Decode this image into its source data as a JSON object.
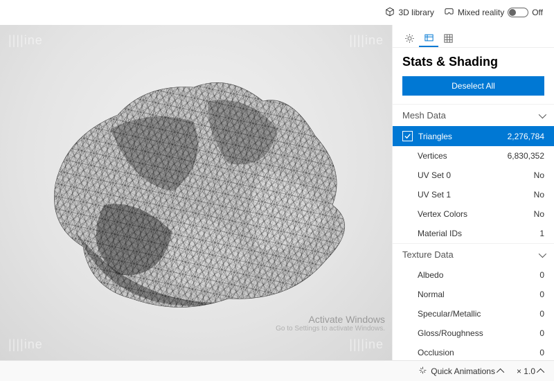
{
  "topbar": {
    "library_label": "3D library",
    "mr_label": "Mixed reality",
    "mr_state": "Off"
  },
  "panel": {
    "title": "Stats & Shading",
    "deselect_label": "Deselect All",
    "sections": {
      "mesh": {
        "title": "Mesh Data"
      },
      "texture": {
        "title": "Texture Data"
      }
    },
    "mesh_rows": [
      {
        "label": "Triangles",
        "value": "2,276,784",
        "selected": true
      },
      {
        "label": "Vertices",
        "value": "6,830,352"
      },
      {
        "label": "UV Set 0",
        "value": "No"
      },
      {
        "label": "UV Set 1",
        "value": "No"
      },
      {
        "label": "Vertex Colors",
        "value": "No"
      },
      {
        "label": "Material IDs",
        "value": "1"
      }
    ],
    "texture_rows": [
      {
        "label": "Albedo",
        "value": "0"
      },
      {
        "label": "Normal",
        "value": "0"
      },
      {
        "label": "Specular/Metallic",
        "value": "0"
      },
      {
        "label": "Gloss/Roughness",
        "value": "0"
      },
      {
        "label": "Occlusion",
        "value": "0"
      }
    ]
  },
  "statusbar": {
    "anim_label": "Quick Animations",
    "zoom_label": "× 1.0"
  },
  "watermark": "||||ine",
  "activate": {
    "title": "Activate Windows",
    "sub": "Go to Settings to activate Windows."
  }
}
